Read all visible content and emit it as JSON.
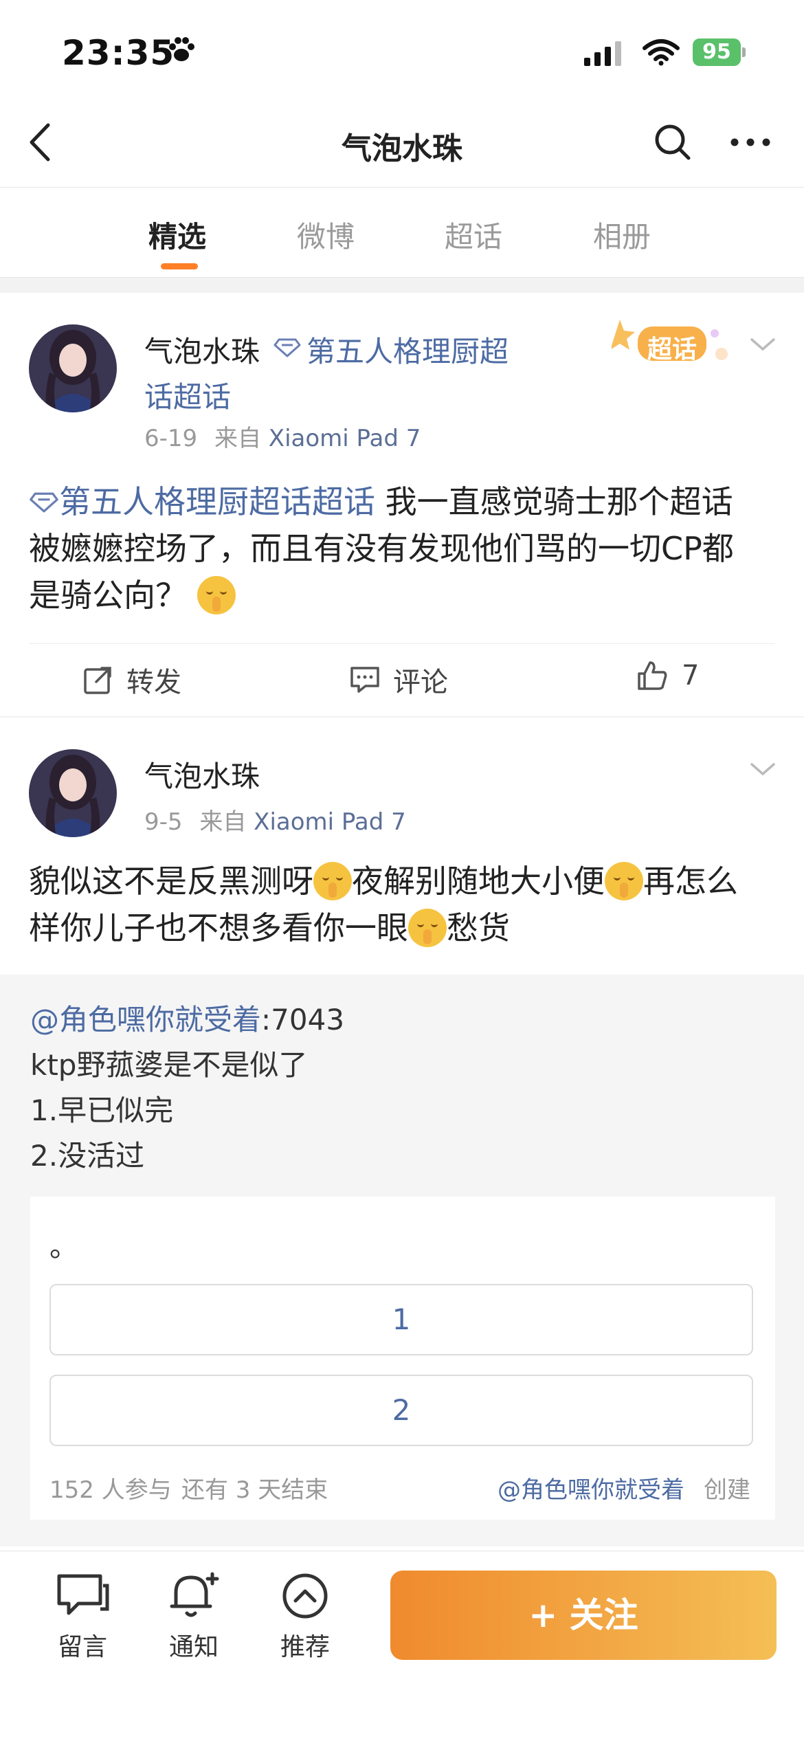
{
  "status_bar": {
    "time": "23:35",
    "battery": "95"
  },
  "nav": {
    "title": "气泡水珠"
  },
  "tabs": [
    {
      "label": "精选",
      "active": true
    },
    {
      "label": "微博",
      "active": false
    },
    {
      "label": "超话",
      "active": false
    },
    {
      "label": "相册",
      "active": false
    }
  ],
  "post1": {
    "author": "气泡水珠",
    "topic_line1": "第五人格理厨超",
    "topic_line2": "话超话",
    "date": "6-19",
    "from_label": "来自",
    "source": "Xiaomi Pad 7",
    "badge": "超话",
    "body_topic": "第五人格理厨超话超话",
    "body_line1": " 我一直感觉骑士那个超话",
    "body_line2": "被嬷嬷控场了，而且有没有发现他们骂的一切CP都",
    "body_line3": "是骑公向？",
    "actions": {
      "repost": "转发",
      "comment": "评论",
      "like_count": "7"
    }
  },
  "post2": {
    "author": "气泡水珠",
    "date": "9-5",
    "from_label": "来自",
    "source": "Xiaomi Pad 7",
    "body_line1_a": "貌似这不是反黑测呀",
    "body_line1_b": "夜解别随地大小便",
    "body_line1_c": "再怎么",
    "body_line2_a": "样你儿子也不想多看你一眼",
    "body_line2_b": "愁货",
    "repost": {
      "at_user": "@角色嘿你就受着",
      "at_suffix": ":7043",
      "line2": "ktp野菰婆是不是似了",
      "line3": "1.早已似完",
      "line4": "2.没活过",
      "poll": {
        "title": "。",
        "options": [
          "1",
          "2"
        ],
        "participants": "152 人参与",
        "remaining": "还有 3 天结束",
        "creator": "@角色嘿你就受着",
        "created_label": "创建"
      }
    }
  },
  "bottom_bar": {
    "message": "留言",
    "notify": "通知",
    "recommend": "推荐",
    "follow": "+ 关注"
  },
  "colors": {
    "accent": "#ff7f27",
    "link": "#4d6ba3",
    "follow_from": "#f08a2e",
    "follow_to": "#f4bf55"
  }
}
